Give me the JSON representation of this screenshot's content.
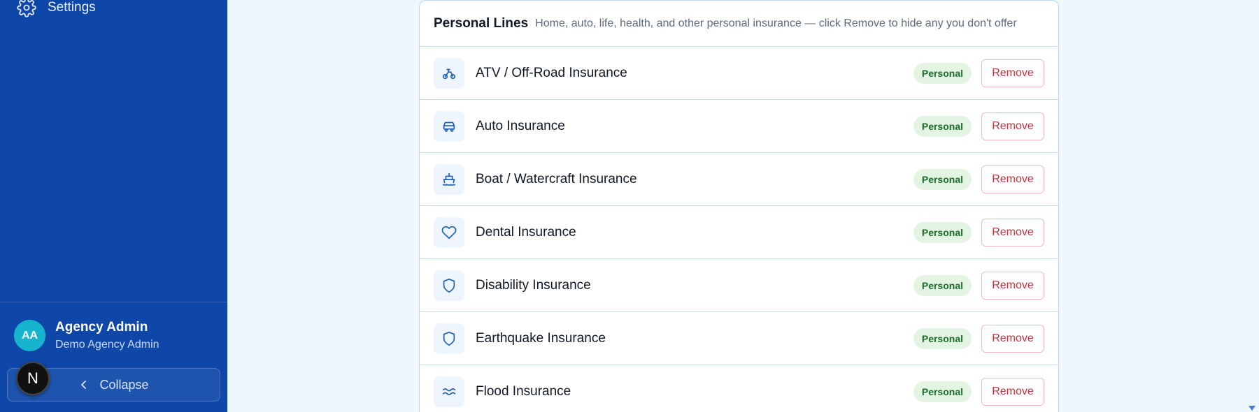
{
  "sidebar": {
    "settings_label": "Settings",
    "user": {
      "initials": "AA",
      "name": "Agency Admin",
      "role": "Demo Agency Admin"
    },
    "collapse_label": "Collapse",
    "next_badge": "N"
  },
  "section": {
    "title": "Personal Lines",
    "description": "Home, auto, life, health, and other personal insurance — click Remove to hide any you don't offer"
  },
  "rows": [
    {
      "name": "ATV / Off-Road Insurance",
      "icon": "atv-icon",
      "badge": "Personal",
      "action": "Remove"
    },
    {
      "name": "Auto Insurance",
      "icon": "car-icon",
      "badge": "Personal",
      "action": "Remove"
    },
    {
      "name": "Boat / Watercraft Insurance",
      "icon": "boat-icon",
      "badge": "Personal",
      "action": "Remove"
    },
    {
      "name": "Dental Insurance",
      "icon": "heart-icon",
      "badge": "Personal",
      "action": "Remove"
    },
    {
      "name": "Disability Insurance",
      "icon": "shield-icon",
      "badge": "Personal",
      "action": "Remove"
    },
    {
      "name": "Earthquake Insurance",
      "icon": "shield-icon",
      "badge": "Personal",
      "action": "Remove"
    },
    {
      "name": "Flood Insurance",
      "icon": "waves-icon",
      "badge": "Personal",
      "action": "Remove"
    }
  ],
  "colors": {
    "sidebar": "#0f47a8",
    "accent_icon": "#1f5fb3",
    "badge_bg": "#e3f4e3",
    "badge_text": "#1e6b2b",
    "remove_text": "#c0333f"
  }
}
